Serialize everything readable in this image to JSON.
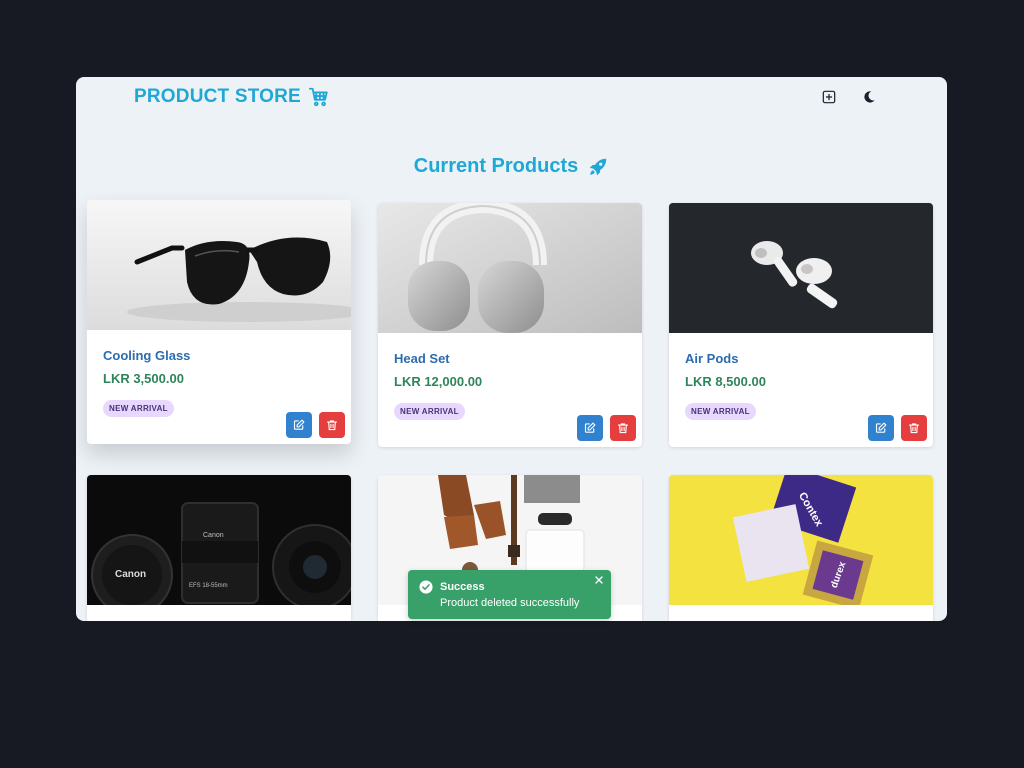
{
  "navbar": {
    "brand": "PRODUCT STORE",
    "brand_icon": "shopping-cart-icon",
    "add_icon": "plus-square-icon",
    "theme_icon": "moon-icon"
  },
  "heading": {
    "title": "Current Products",
    "icon": "rocket-icon"
  },
  "products": [
    {
      "name": "Cooling Glass",
      "price": "LKR  3,500.00",
      "badge": "NEW ARRIVAL"
    },
    {
      "name": "Head Set",
      "price": "LKR  12,000.00",
      "badge": "NEW ARRIVAL"
    },
    {
      "name": "Air Pods",
      "price": "LKR  8,500.00",
      "badge": "NEW ARRIVAL"
    },
    {
      "name": "",
      "price": "",
      "badge": ""
    },
    {
      "name": "",
      "price": "",
      "badge": ""
    },
    {
      "name": "",
      "price": "",
      "badge": ""
    }
  ],
  "toast": {
    "title": "Success",
    "message": "Product deleted successfully",
    "status_icon": "check-circle-icon",
    "close_icon": "close-icon"
  },
  "colors": {
    "page_bg": "#171923",
    "window_bg": "#edf2f7",
    "brand": "#1fa8d6",
    "name": "#2b6cb0",
    "price": "#2f855a",
    "edit": "#3182ce",
    "delete": "#e53e3e",
    "toast": "#38a169",
    "badge_bg": "#e9d8fd"
  }
}
